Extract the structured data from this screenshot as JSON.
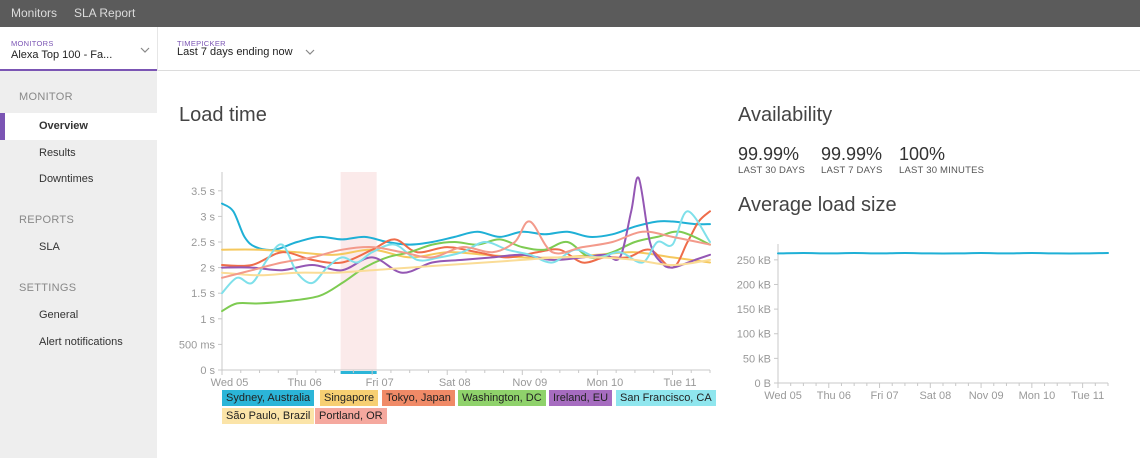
{
  "topnav": {
    "monitors_label": "Monitors",
    "sla_label": "SLA Report"
  },
  "monitor_selector": {
    "label": "MONITORS",
    "value": "Alexa Top 100 - Fa..."
  },
  "time_picker": {
    "label": "TIMEPICKER",
    "value": "Last 7 days ending now"
  },
  "sidebar": {
    "sections": [
      {
        "title": "MONITOR",
        "items": [
          "Overview",
          "Results",
          "Downtimes"
        ]
      },
      {
        "title": "REPORTS",
        "items": [
          "SLA"
        ]
      },
      {
        "title": "SETTINGS",
        "items": [
          "General",
          "Alert notifications"
        ]
      }
    ],
    "active_item": "Overview"
  },
  "load_time": {
    "title": "Load time",
    "legend": [
      {
        "name": "Sydney, Australia",
        "bg": "#2bb5d8"
      },
      {
        "name": "Singapore",
        "bg": "#f7cf72"
      },
      {
        "name": "Tokyo, Japan",
        "bg": "#f08a67"
      },
      {
        "name": "Washington, DC",
        "bg": "#8fd26b"
      },
      {
        "name": "Ireland, EU",
        "bg": "#a66cc0"
      },
      {
        "name": "San Francisco, CA",
        "bg": "#8fe6ee"
      },
      {
        "name": "São Paulo, Brazil",
        "bg": "#fbe4a8"
      },
      {
        "name": "Portland, OR",
        "bg": "#f5a89e"
      }
    ]
  },
  "availability": {
    "title": "Availability",
    "stats": [
      {
        "value": "99.99%",
        "label": "LAST 30 DAYS"
      },
      {
        "value": "99.99%",
        "label": "LAST 7 DAYS"
      },
      {
        "value": "100%",
        "label": "LAST 30 MINUTES"
      }
    ]
  },
  "load_size": {
    "title": "Average load size"
  },
  "chart_data": [
    {
      "type": "line",
      "title": "Load time",
      "y_ticks": [
        "0 s",
        "500 ms",
        "1 s",
        "1.5 s",
        "2 s",
        "2.5 s",
        "3 s",
        "3.5 s"
      ],
      "x_ticks": [
        "Wed 05",
        "Thu 06",
        "Fri 07",
        "Sat 08",
        "Nov 09",
        "Mon 10",
        "Tue 11"
      ],
      "ylim": [
        0,
        3.75
      ],
      "xlim": [
        0,
        6.5
      ],
      "highlight_range": [
        1.58,
        2.06
      ],
      "series": [
        {
          "name": "Sydney, Australia",
          "color": "#1fb0d6",
          "x": [
            0,
            0.15,
            0.3,
            0.45,
            0.7,
            1.0,
            1.3,
            1.6,
            1.9,
            2.2,
            2.5,
            2.8,
            3.1,
            3.4,
            3.7,
            4.0,
            4.3,
            4.6,
            4.9,
            5.2,
            5.5,
            5.8,
            6.0,
            6.3,
            6.5
          ],
          "y": [
            3.25,
            3.1,
            2.6,
            2.4,
            2.35,
            2.5,
            2.6,
            2.55,
            2.6,
            2.5,
            2.45,
            2.5,
            2.6,
            2.7,
            2.6,
            2.7,
            2.65,
            2.7,
            2.6,
            2.65,
            2.8,
            2.9,
            2.9,
            2.85,
            2.85
          ]
        },
        {
          "name": "Singapore",
          "color": "#f5c85d",
          "x": [
            0,
            0.5,
            1.0,
            1.5,
            2.0,
            2.5,
            3.0,
            3.5,
            4.0,
            4.5,
            5.0,
            5.5,
            6.0,
            6.5
          ],
          "y": [
            2.35,
            2.35,
            2.3,
            2.25,
            2.35,
            2.2,
            2.3,
            2.25,
            2.2,
            2.2,
            2.25,
            2.3,
            2.2,
            2.1
          ]
        },
        {
          "name": "Tokyo, Japan",
          "color": "#ee6c4a",
          "x": [
            0,
            0.4,
            0.8,
            1.2,
            1.6,
            2.0,
            2.3,
            2.6,
            3.0,
            3.4,
            3.8,
            4.2,
            4.5,
            4.8,
            5.1,
            5.4,
            5.7,
            6.0,
            6.2,
            6.35,
            6.5
          ],
          "y": [
            2.05,
            2.05,
            2.3,
            2.15,
            2.1,
            2.35,
            2.55,
            2.3,
            2.4,
            2.3,
            2.2,
            2.3,
            2.35,
            2.1,
            2.2,
            2.2,
            2.35,
            2.0,
            2.5,
            2.9,
            3.1
          ]
        },
        {
          "name": "Washington, DC",
          "color": "#7ecb52",
          "x": [
            0,
            0.2,
            0.5,
            0.9,
            1.3,
            1.6,
            1.9,
            2.2,
            2.5,
            2.8,
            3.1,
            3.4,
            3.7,
            4.0,
            4.3,
            4.6,
            4.9,
            5.2,
            5.5,
            5.8,
            6.1,
            6.5
          ],
          "y": [
            1.15,
            1.3,
            1.3,
            1.35,
            1.45,
            1.7,
            2.0,
            2.2,
            2.3,
            2.45,
            2.5,
            2.45,
            2.55,
            2.4,
            2.35,
            2.5,
            2.2,
            2.3,
            2.5,
            2.6,
            2.7,
            2.45
          ]
        },
        {
          "name": "Ireland, EU",
          "color": "#9457b4",
          "x": [
            0,
            0.4,
            0.8,
            1.2,
            1.6,
            2.0,
            2.4,
            2.8,
            3.2,
            3.6,
            4.0,
            4.4,
            4.8,
            5.1,
            5.3,
            5.45,
            5.55,
            5.7,
            5.85,
            6.0,
            6.3,
            6.5
          ],
          "y": [
            2.0,
            2.0,
            1.95,
            2.05,
            1.95,
            2.2,
            1.9,
            2.1,
            2.15,
            2.2,
            2.25,
            2.15,
            2.2,
            2.25,
            2.2,
            3.1,
            3.75,
            2.5,
            2.1,
            2.0,
            2.15,
            2.25
          ]
        },
        {
          "name": "San Francisco, CA",
          "color": "#7fe0ea",
          "x": [
            0,
            0.2,
            0.4,
            0.6,
            0.8,
            1.0,
            1.2,
            1.4,
            1.6,
            1.8,
            2.0,
            2.3,
            2.6,
            2.9,
            3.2,
            3.5,
            3.8,
            4.1,
            4.4,
            4.7,
            5.0,
            5.3,
            5.6,
            5.8,
            6.0,
            6.2,
            6.5
          ],
          "y": [
            1.5,
            1.8,
            1.7,
            2.15,
            2.45,
            1.9,
            1.7,
            2.0,
            2.2,
            2.1,
            2.3,
            2.45,
            2.15,
            2.2,
            2.3,
            2.5,
            2.35,
            2.25,
            2.1,
            2.35,
            2.2,
            2.3,
            2.1,
            2.5,
            2.45,
            3.1,
            2.5
          ]
        },
        {
          "name": "São Paulo, Brazil",
          "color": "#fadc96",
          "x": [
            0,
            0.5,
            1.0,
            1.5,
            2.0,
            2.5,
            3.0,
            3.5,
            4.0,
            4.5,
            5.0,
            5.5,
            6.0,
            6.5
          ],
          "y": [
            1.9,
            1.85,
            1.9,
            1.9,
            1.95,
            2.0,
            2.05,
            2.1,
            2.15,
            2.2,
            2.2,
            2.15,
            2.05,
            2.15
          ]
        },
        {
          "name": "Portland, OR",
          "color": "#f39a8b",
          "x": [
            0,
            0.4,
            0.8,
            1.2,
            1.6,
            2.0,
            2.4,
            2.8,
            3.2,
            3.6,
            3.9,
            4.1,
            4.4,
            4.8,
            5.2,
            5.6,
            6.0,
            6.5
          ],
          "y": [
            1.8,
            1.95,
            2.1,
            2.2,
            2.35,
            2.4,
            2.3,
            2.2,
            2.4,
            2.3,
            2.5,
            2.9,
            2.3,
            2.4,
            2.5,
            2.7,
            2.6,
            2.45
          ]
        }
      ]
    },
    {
      "type": "line",
      "title": "Average load size",
      "y_ticks": [
        "0 B",
        "50 kB",
        "100 kB",
        "150 kB",
        "200 kB",
        "250 kB"
      ],
      "x_ticks": [
        "Wed 05",
        "Thu 06",
        "Fri 07",
        "Sat 08",
        "Nov 09",
        "Mon 10",
        "Tue 11"
      ],
      "ylim": [
        0,
        270
      ],
      "xlim": [
        0,
        6.5
      ],
      "series": [
        {
          "name": "",
          "color": "#1fb0d6",
          "x": [
            0,
            0.5,
            1.0,
            1.5,
            2.0,
            2.5,
            3.0,
            3.5,
            4.0,
            4.5,
            5.0,
            5.5,
            6.0,
            6.5
          ],
          "y": [
            263,
            264,
            263,
            264,
            263,
            264,
            263,
            263,
            264,
            263,
            264,
            263,
            263,
            264
          ]
        }
      ]
    }
  ]
}
